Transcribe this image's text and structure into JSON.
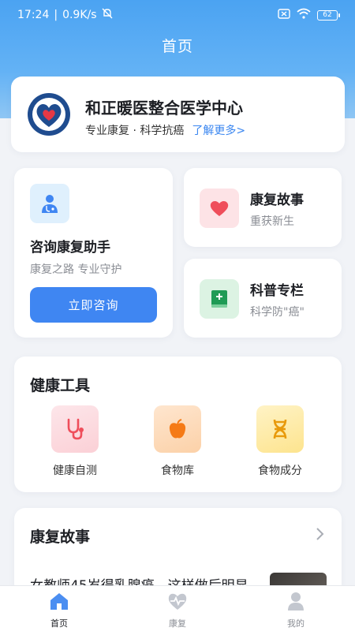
{
  "statusbar": {
    "time": "17:24",
    "speed": "0.9K/s",
    "battery": "62"
  },
  "header": {
    "title": "首页"
  },
  "org": {
    "name": "和正暖医整合医学中心",
    "tagline": "专业康复 · 科学抗癌",
    "link": "了解更多>"
  },
  "consult": {
    "title": "咨询康复助手",
    "subtitle": "康复之路 专业守护",
    "button": "立即咨询"
  },
  "story_card": {
    "title": "康复故事",
    "subtitle": "重获新生"
  },
  "science_card": {
    "title": "科普专栏",
    "subtitle": "科学防\"癌\""
  },
  "tools": {
    "title": "健康工具",
    "items": [
      {
        "label": "健康自测",
        "icon": "stethoscope-icon"
      },
      {
        "label": "食物库",
        "icon": "apple-icon"
      },
      {
        "label": "食物成分",
        "icon": "dna-icon"
      }
    ]
  },
  "stories": {
    "title": "康复故事",
    "snippet": "女教师45岁得乳腺癌，这样做后明显"
  },
  "tabbar": {
    "items": [
      {
        "label": "首页",
        "icon": "home-icon",
        "active": true
      },
      {
        "label": "康复",
        "icon": "heart-pulse-icon",
        "active": false
      },
      {
        "label": "我的",
        "icon": "user-icon",
        "active": false
      }
    ]
  },
  "colors": {
    "accent": "#3f86f2",
    "header_gradient_top": "#4ba3f2",
    "page_bg": "#f1f3f7"
  }
}
